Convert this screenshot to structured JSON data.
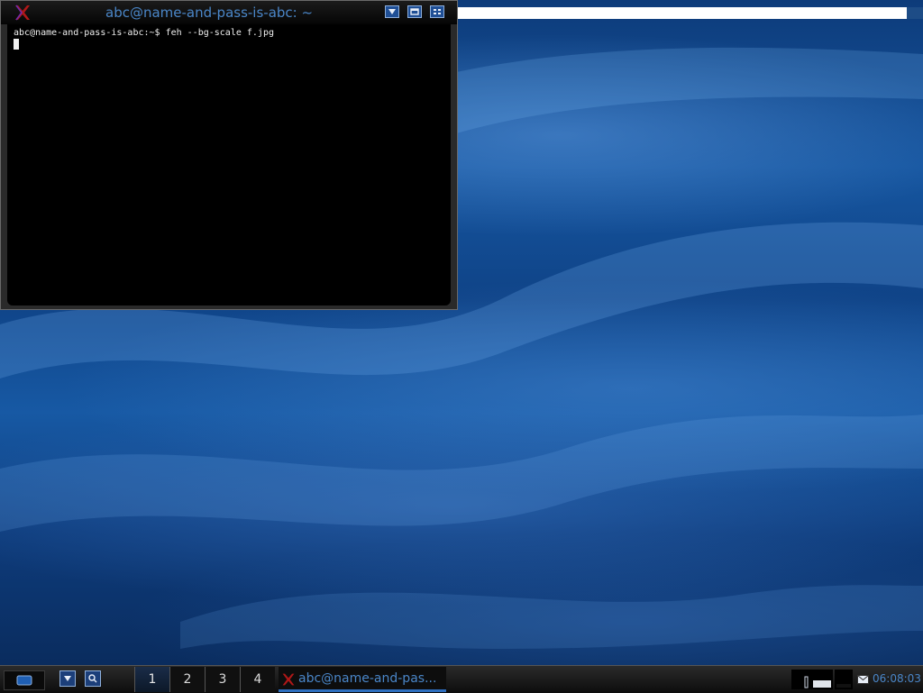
{
  "window": {
    "title": "abc@name-and-pass-is-abc: ~",
    "buttons": [
      "minimize",
      "maximize",
      "close"
    ]
  },
  "terminal": {
    "prompt_line": "abc@name-and-pass-is-abc:~$ feh --bg-scale f.jpg"
  },
  "taskbar": {
    "desktops": [
      "1",
      "2",
      "3",
      "4"
    ],
    "active_desktop": "1",
    "task_label": "abc@name-and-pas...",
    "clock": "06:08:03"
  },
  "colors": {
    "title_text": "#4a86c8",
    "taskbar_bg": "#1a1a1a",
    "terminal_bg": "#000000"
  }
}
